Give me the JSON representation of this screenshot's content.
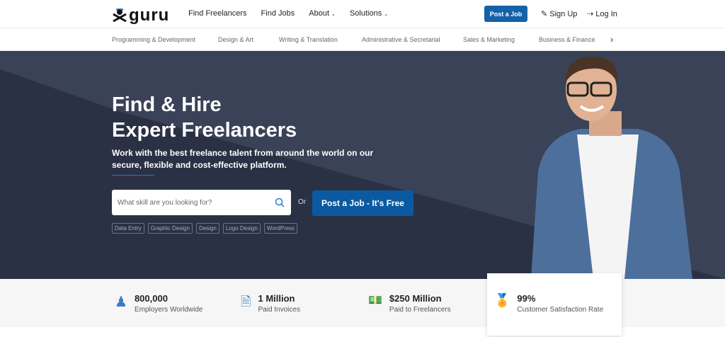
{
  "header": {
    "logo": "guru",
    "nav": [
      "Find Freelancers",
      "Find Jobs",
      "About",
      "Solutions"
    ],
    "post_job": "Post a Job",
    "sign_up": "Sign Up",
    "log_in": "Log In"
  },
  "categories": [
    "Programming & Development",
    "Design & Art",
    "Writing & Translation",
    "Administrative & Secretarial",
    "Sales & Marketing",
    "Business & Finance"
  ],
  "hero": {
    "title_1": "Find & Hire",
    "title_2": "Expert Freelancers",
    "subtitle": "Work with the best freelance talent from around the world on our secure, flexible and cost-effective platform.",
    "search_placeholder": "What skill are you looking for?",
    "or": "Or",
    "cta": "Post a Job - It's Free",
    "tags": [
      "Data Entry",
      "Graphic Design",
      "Design",
      "Logo Design",
      "WordPress"
    ]
  },
  "stats": [
    {
      "num": "800,000",
      "label": "Employers Worldwide"
    },
    {
      "num": "1 Million",
      "label": "Paid Invoices"
    },
    {
      "num": "$250 Million",
      "label": "Paid to Freelancers"
    },
    {
      "num": "99%",
      "label": "Customer Satisfaction Rate"
    }
  ],
  "colors": {
    "accent": "#1561a8",
    "hero_bg": "#2b3144"
  }
}
